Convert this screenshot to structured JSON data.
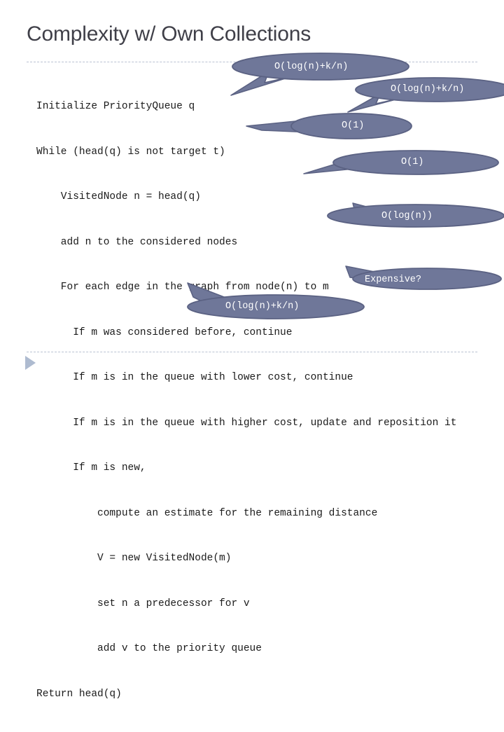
{
  "slide": {
    "title": "Complexity w/ Own Collections",
    "decorations": {
      "top_rule": "dashed-rule",
      "bottom_rule": "dashed-rule",
      "bullet_marker": "play-triangle"
    },
    "colors": {
      "title": "#3f3f48",
      "code_text": "#1a1a1a",
      "callout_fill": "#6f7799",
      "callout_stroke": "#5b6283",
      "callout_text": "#ffffff",
      "rule": "#b9c2d2",
      "triangle": "#aebbd0",
      "background": "#ffffff"
    }
  },
  "code": {
    "lines": [
      "Initialize PriorityQueue q",
      "While (head(q) is not target t)",
      "    VisitedNode n = head(q)",
      "    add n to the considered nodes",
      "    For each edge in the graph from node(n) to m",
      "      If m was considered before, continue",
      "      If m is in the queue with lower cost, continue",
      "      If m is in the queue with higher cost, update and reposition it",
      "      If m is new,",
      "          compute an estimate for the remaining distance",
      "          V = new VisitedNode(m)",
      "          set n a predecessor for v",
      "          add v to the priority queue",
      "Return head(q)"
    ]
  },
  "callouts": [
    {
      "id": "callout-1",
      "label": "O(log(n)+k/n)",
      "target_line": "While (head(q) is not target t)"
    },
    {
      "id": "callout-2",
      "label": "O(log(n)+k/n)",
      "target_line": "While (head(q) is not target t)"
    },
    {
      "id": "callout-3",
      "label": "O(1)",
      "target_line": "add n to the considered nodes"
    },
    {
      "id": "callout-4",
      "label": "O(1)",
      "target_line": "If m was considered before, continue"
    },
    {
      "id": "callout-5",
      "label": "O(log(n))",
      "target_line": "compute an estimate for the remaining distance"
    },
    {
      "id": "callout-6",
      "label": "Expensive?",
      "target_line": "add v to the priority queue"
    },
    {
      "id": "callout-7",
      "label": "O(log(n)+k/n)",
      "target_line": "Return head(q)"
    }
  ]
}
